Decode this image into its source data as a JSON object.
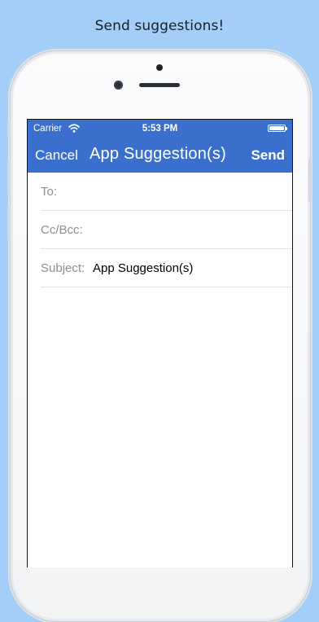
{
  "headline": "Send suggestions!",
  "status_bar": {
    "carrier": "Carrier",
    "time": "5:53 PM",
    "wifi_icon": "wifi-icon",
    "battery_icon": "battery-icon"
  },
  "nav": {
    "cancel_label": "Cancel",
    "title": "App Suggestion(s)",
    "send_label": "Send"
  },
  "compose": {
    "to_label": "To:",
    "to_value": "",
    "cc_label": "Cc/Bcc:",
    "cc_value": "",
    "subject_label": "Subject:",
    "subject_value": "App Suggestion(s)",
    "body": ""
  },
  "colors": {
    "background": "#a3cef8",
    "navbar": "#3b6fce",
    "label_gray": "#8e8e93"
  }
}
